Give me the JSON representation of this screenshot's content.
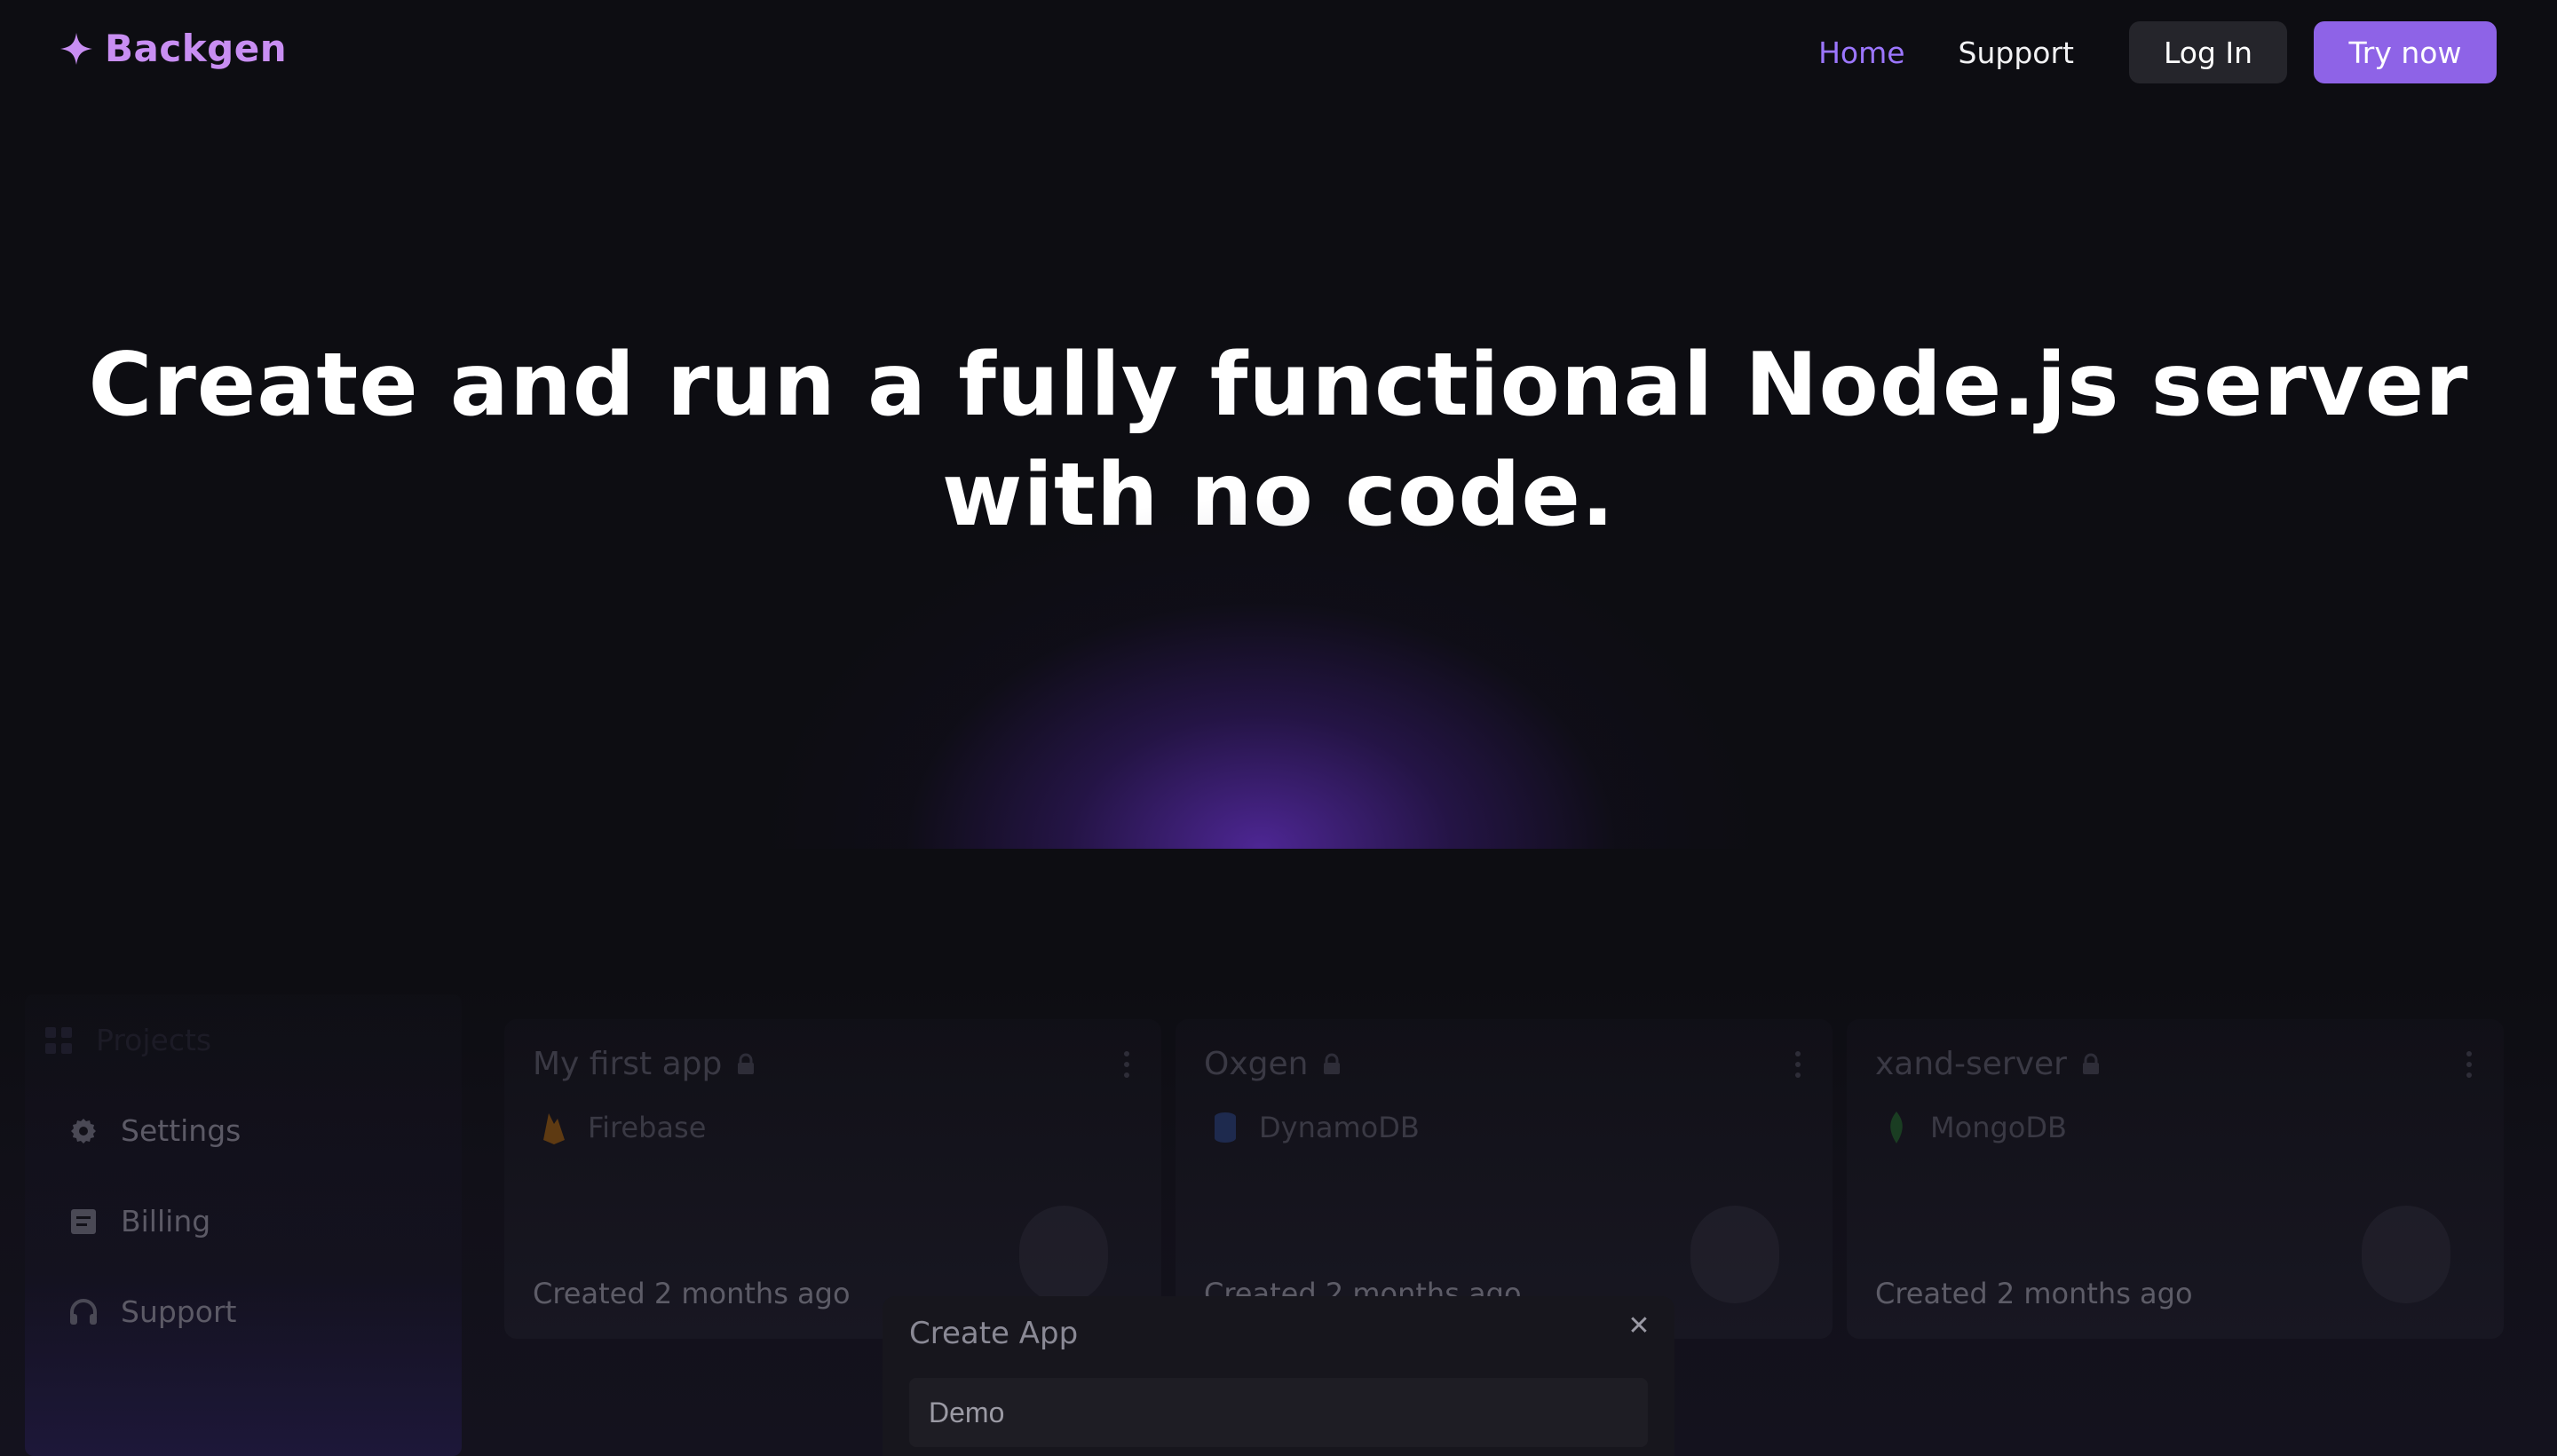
{
  "brand": {
    "name": "Backgen",
    "icon": "sparkle-icon",
    "color": "#c88ef2"
  },
  "nav": {
    "links": [
      {
        "label": "Home",
        "active": true
      },
      {
        "label": "Support",
        "active": false
      }
    ],
    "login_label": "Log In",
    "try_label": "Try now",
    "accent": "#9c76ff",
    "cta_color": "#8e63e7"
  },
  "hero": {
    "line1": "Create and run a fully functional Node.js server",
    "line2": "with no code."
  },
  "sidebar": {
    "items": [
      {
        "label": "Projects",
        "icon": "grid-icon"
      },
      {
        "label": "Settings",
        "icon": "gear-icon"
      },
      {
        "label": "Billing",
        "icon": "receipt-icon"
      },
      {
        "label": "Support",
        "icon": "headphones-icon"
      }
    ]
  },
  "projects": [
    {
      "name": "My first app",
      "db": "Firebase",
      "db_icon": "firebase-icon",
      "created": "Created 2 months ago"
    },
    {
      "name": "Oxgen",
      "db": "DynamoDB",
      "db_icon": "dynamodb-icon",
      "created": "Created 2 months ago"
    },
    {
      "name": "xand-server",
      "db": "MongoDB",
      "db_icon": "mongodb-icon",
      "created": "Created 2 months ago"
    }
  ],
  "modal": {
    "title": "Create App",
    "close_icon": "close-icon",
    "input_value": "Demo"
  }
}
